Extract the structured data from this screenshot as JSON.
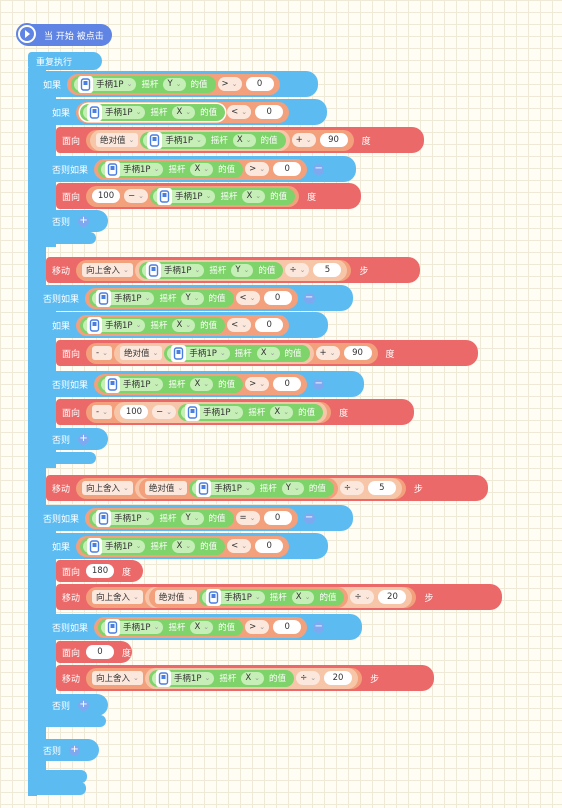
{
  "controller": "手柄1P",
  "joystick": "摇杆",
  "value_of": "的值",
  "axis_x": "X",
  "axis_y": "Y",
  "labels": {
    "when_start": "当 开始 被点击",
    "forever": "重复执行",
    "if": "如果",
    "else_if": "否则如果",
    "else": "否则",
    "face": "面向",
    "move": "移动",
    "degrees": "度",
    "steps": "步",
    "abs": "绝对值",
    "round_up": "向上舍入",
    "neg": "-"
  },
  "ops": {
    "gt": ">",
    "lt": "<",
    "eq": "=",
    "plus": "+",
    "minus": "−",
    "div": "÷"
  },
  "numbers": {
    "zero": "0",
    "ninety": "90",
    "hundred": "100",
    "five": "5",
    "one_eighty": "180",
    "twenty": "20"
  },
  "colors": {
    "control": "#5cbcf2",
    "motion": "#ec6969",
    "operator": "#f3a07c",
    "sensing": "#7ed36a",
    "event": "#5f84e3"
  }
}
